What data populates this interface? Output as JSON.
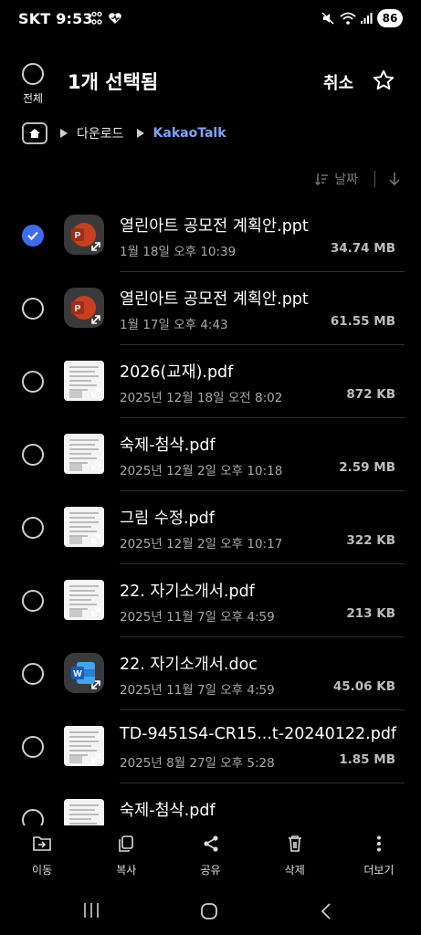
{
  "status_bar": {
    "carrier": "SKT",
    "time": "9:53",
    "battery": "86"
  },
  "header": {
    "select_all_label": "전체",
    "title": "1개 선택됨",
    "cancel_label": "취소"
  },
  "breadcrumb": {
    "items": [
      "다운로드",
      "KakaoTalk"
    ]
  },
  "sort": {
    "label": "날짜"
  },
  "files": [
    {
      "name": "열린아트 공모전 계획안.ppt",
      "date": "1월 18일 오후 10:39",
      "size": "34.74 MB",
      "type": "ppt",
      "selected": true
    },
    {
      "name": "열린아트 공모전 계획안.ppt",
      "date": "1월 17일 오후 4:43",
      "size": "61.55 MB",
      "type": "ppt",
      "selected": false
    },
    {
      "name": "2026(교재).pdf",
      "date": "2025년 12월 18일 오전 8:02",
      "size": "872 KB",
      "type": "pdf",
      "selected": false
    },
    {
      "name": "숙제-첨삭.pdf",
      "date": "2025년 12월 2일 오후 10:18",
      "size": "2.59 MB",
      "type": "pdf",
      "selected": false
    },
    {
      "name": "그림 수정.pdf",
      "date": "2025년 12월 2일 오후 10:17",
      "size": "322 KB",
      "type": "pdf",
      "selected": false
    },
    {
      "name": "22. 자기소개서.pdf",
      "date": "2025년 11월 7일 오후 4:59",
      "size": "213 KB",
      "type": "pdf",
      "selected": false
    },
    {
      "name": "22. 자기소개서.doc",
      "date": "2025년 11월 7일 오후 4:59",
      "size": "45.06 KB",
      "type": "doc",
      "selected": false
    },
    {
      "name": "TD-9451S4-CR15...t-20240122.pdf",
      "date": "2025년 8월 27일 오후 5:28",
      "size": "1.85 MB",
      "type": "pdf",
      "selected": false
    },
    {
      "name": "숙제-첨삭.pdf",
      "date": "",
      "size": "",
      "type": "pdf",
      "selected": false
    }
  ],
  "actions": [
    {
      "label": "이동",
      "icon": "move-icon"
    },
    {
      "label": "복사",
      "icon": "copy-icon"
    },
    {
      "label": "공유",
      "icon": "share-icon"
    },
    {
      "label": "삭제",
      "icon": "trash-icon"
    },
    {
      "label": "더보기",
      "icon": "more-vertical-icon"
    }
  ],
  "colors": {
    "accent": "#3c6cf0",
    "breadcrumb_active": "#7ea4ff",
    "ppt": "#c6401f",
    "word": "#185abd"
  }
}
